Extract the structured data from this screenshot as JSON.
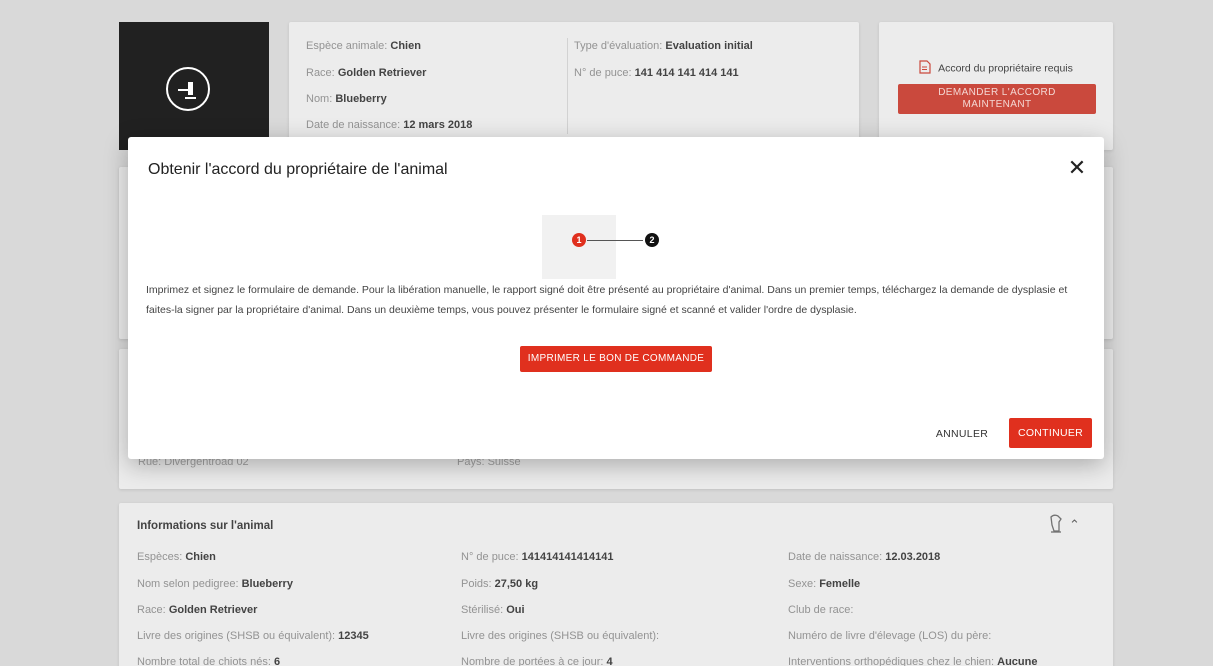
{
  "summary": {
    "species_label": "Espèce animale:",
    "species_value": "Chien",
    "breed_label": "Race:",
    "breed_value": "Golden Retriever",
    "name_label": "Nom:",
    "name_value": "Blueberry",
    "birth_label": "Date de naissance:",
    "birth_value": "12 mars 2018",
    "eval_label": "Type d'évaluation:",
    "eval_value": "Evaluation initial",
    "chip_label": "N° de puce:",
    "chip_value": "141 414 141 414 141"
  },
  "consent": {
    "notice": "Accord du propriétaire requis",
    "button_line1": "DEMANDER L'ACCORD",
    "button_line2": "MAINTENANT"
  },
  "partial_row": {
    "left": "Rue: Divergentroad 02",
    "middle": "Pays: Suisse"
  },
  "animal_info": {
    "title": "Informations sur l'animal",
    "rows": [
      {
        "c1_label": "Espèces:",
        "c1_value": "Chien",
        "c2_label": "N° de puce:",
        "c2_value": "141414141414141",
        "c3_label": "Date de naissance:",
        "c3_value": "12.03.2018"
      },
      {
        "c1_label": "Nom selon pedigree:",
        "c1_value": "Blueberry",
        "c2_label": "Poids:",
        "c2_value": "27,50 kg",
        "c3_label": "Sexe:",
        "c3_value": "Femelle"
      },
      {
        "c1_label": "Race:",
        "c1_value": "Golden Retriever",
        "c2_label": "Stérilisé:",
        "c2_value": "Oui",
        "c3_label": "Club de race:",
        "c3_value": ""
      },
      {
        "c1_label": "Livre des origines (SHSB ou équivalent):",
        "c1_value": "12345",
        "c2_label": "Livre des origines (SHSB ou équivalent):",
        "c2_value": "",
        "c3_label": "Numéro de livre d'élevage (LOS) du père:",
        "c3_value": ""
      },
      {
        "c1_label": "Nombre total de chiots nés:",
        "c1_value": "6",
        "c2_label": "Nombre de portées à ce jour:",
        "c2_value": "4",
        "c3_label": "Interventions orthopédiques chez le chien:",
        "c3_value": "Aucune"
      }
    ]
  },
  "modal": {
    "title": "Obtenir l'accord du propriétaire de l'animal",
    "close_glyph": "✕",
    "steps": [
      "1",
      "2"
    ],
    "text": "Imprimez et signez le formulaire de demande. Pour la libération manuelle, le rapport signé doit être présenté au propriétaire d'animal. Dans un premier temps, téléchargez la demande de dysplasie et faites-la signer par la propriétaire d'animal. Dans un deuxième temps, vous pouvez présenter le formulaire signé et scanné et valider l'ordre de dysplasie.",
    "print_button": "IMPRIMER LE BON DE COMMANDE",
    "cancel_button": "ANNULER",
    "continue_button": "CONTINUER"
  },
  "colors": {
    "accent": "#e0301e",
    "step_inactive": "#111111"
  },
  "icons": {
    "logo": "gavel-icon",
    "consent": "document-icon",
    "animal": "dog-icon",
    "collapse": "chevron-up-icon"
  }
}
